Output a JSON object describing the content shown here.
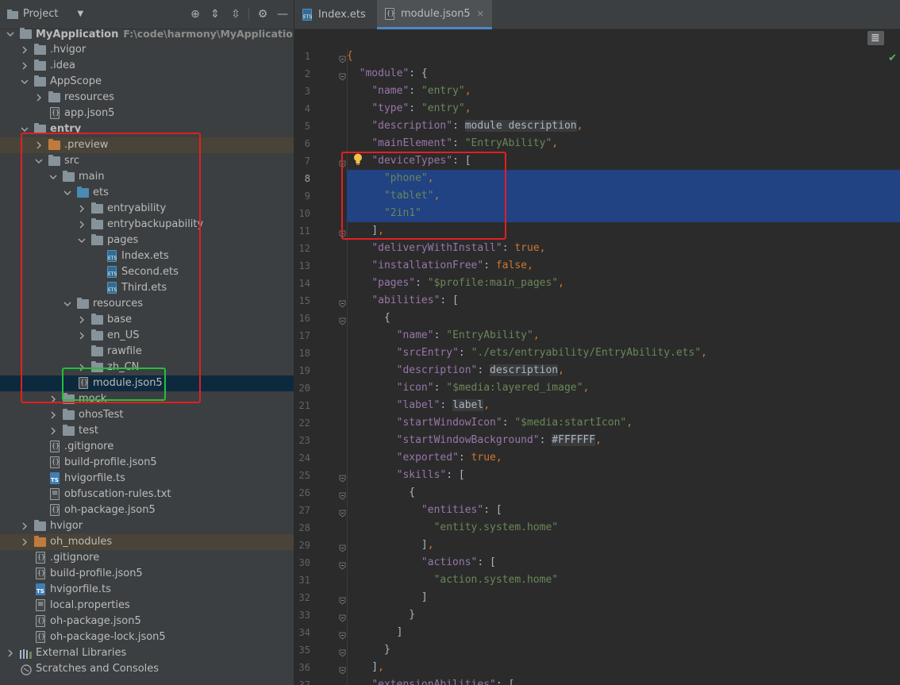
{
  "project_panel": {
    "title": "Project",
    "header_icons": [
      "locate-icon",
      "expand-all-icon",
      "collapse-all-icon",
      "settings-icon",
      "hide-icon"
    ],
    "tree": [
      {
        "label": "MyApplication",
        "path": "F:\\code\\harmony\\MyApplication",
        "icon": "module-folder",
        "level": 0,
        "expanded": true,
        "bold": true
      },
      {
        "label": ".hvigor",
        "icon": "folder",
        "level": 1,
        "expanded": false
      },
      {
        "label": ".idea",
        "icon": "folder",
        "level": 1,
        "expanded": false
      },
      {
        "label": "AppScope",
        "icon": "folder",
        "level": 1,
        "expanded": true
      },
      {
        "label": "resources",
        "icon": "folder",
        "level": 2,
        "expanded": false
      },
      {
        "label": "app.json5",
        "icon": "json-file",
        "level": 2
      },
      {
        "label": "entry",
        "icon": "module-folder",
        "level": 1,
        "expanded": true,
        "bold": true
      },
      {
        "label": ".preview",
        "icon": "orange-folder",
        "level": 2,
        "expanded": false,
        "highlight": "orange"
      },
      {
        "label": "src",
        "icon": "folder",
        "level": 2,
        "expanded": true
      },
      {
        "label": "main",
        "icon": "folder",
        "level": 3,
        "expanded": true
      },
      {
        "label": "ets",
        "icon": "blue-folder",
        "level": 4,
        "expanded": true
      },
      {
        "label": "entryability",
        "icon": "folder",
        "level": 5,
        "expanded": false
      },
      {
        "label": "entrybackupability",
        "icon": "folder",
        "level": 5,
        "expanded": false
      },
      {
        "label": "pages",
        "icon": "folder",
        "level": 5,
        "expanded": true
      },
      {
        "label": "Index.ets",
        "icon": "ets-file",
        "level": 6
      },
      {
        "label": "Second.ets",
        "icon": "ets-file",
        "level": 6
      },
      {
        "label": "Third.ets",
        "icon": "ets-file",
        "level": 6
      },
      {
        "label": "resources",
        "icon": "folder",
        "level": 4,
        "expanded": true
      },
      {
        "label": "base",
        "icon": "folder",
        "level": 5,
        "expanded": false
      },
      {
        "label": "en_US",
        "icon": "folder",
        "level": 5,
        "expanded": false
      },
      {
        "label": "rawfile",
        "icon": "folder",
        "level": 5
      },
      {
        "label": "zh_CN",
        "icon": "folder",
        "level": 5,
        "expanded": false
      },
      {
        "label": "module.json5",
        "icon": "json-file",
        "level": 4,
        "selected": true
      },
      {
        "label": "mock",
        "icon": "folder",
        "level": 3,
        "expanded": false
      },
      {
        "label": "ohosTest",
        "icon": "folder",
        "level": 3,
        "expanded": false
      },
      {
        "label": "test",
        "icon": "folder",
        "level": 3,
        "expanded": false
      },
      {
        "label": ".gitignore",
        "icon": "json-file",
        "level": 2
      },
      {
        "label": "build-profile.json5",
        "icon": "json-file",
        "level": 2
      },
      {
        "label": "hvigorfile.ts",
        "icon": "ts-file",
        "level": 2
      },
      {
        "label": "obfuscation-rules.txt",
        "icon": "txt-file",
        "level": 2
      },
      {
        "label": "oh-package.json5",
        "icon": "json-file",
        "level": 2
      },
      {
        "label": "hvigor",
        "icon": "folder",
        "level": 1,
        "expanded": false
      },
      {
        "label": "oh_modules",
        "icon": "orange-folder",
        "level": 1,
        "expanded": false,
        "highlight": "orange"
      },
      {
        "label": ".gitignore",
        "icon": "json-file",
        "level": 1
      },
      {
        "label": "build-profile.json5",
        "icon": "json-file",
        "level": 1
      },
      {
        "label": "hvigorfile.ts",
        "icon": "ts-file",
        "level": 1
      },
      {
        "label": "local.properties",
        "icon": "txt-file",
        "level": 1
      },
      {
        "label": "oh-package.json5",
        "icon": "json-file",
        "level": 1
      },
      {
        "label": "oh-package-lock.json5",
        "icon": "json-file",
        "level": 1
      },
      {
        "label": "External Libraries",
        "icon": "library",
        "level": 0,
        "expanded": false
      },
      {
        "label": "Scratches and Consoles",
        "icon": "scratches",
        "level": 0
      }
    ]
  },
  "editor": {
    "tabs": [
      {
        "label": "Index.ets",
        "icon": "ets-file",
        "active": false
      },
      {
        "label": "module.json5",
        "icon": "json-file",
        "active": true
      }
    ],
    "close_glyph": "✕",
    "lines": [
      {
        "n": "1",
        "tokens": [
          [
            "pun",
            "{"
          ]
        ]
      },
      {
        "n": "2",
        "tokens": [
          [
            "ind",
            "  "
          ],
          [
            "key",
            "\"module\""
          ],
          [
            "ind",
            ": {"
          ]
        ]
      },
      {
        "n": "3",
        "tokens": [
          [
            "ind",
            "    "
          ],
          [
            "key",
            "\"name\""
          ],
          [
            "ind",
            ": "
          ],
          [
            "str",
            "\"entry\""
          ],
          [
            "pun",
            ","
          ]
        ]
      },
      {
        "n": "4",
        "tokens": [
          [
            "ind",
            "    "
          ],
          [
            "key",
            "\"type\""
          ],
          [
            "ind",
            ": "
          ],
          [
            "str",
            "\"entry\""
          ],
          [
            "pun",
            ","
          ]
        ]
      },
      {
        "n": "5",
        "tokens": [
          [
            "ind",
            "    "
          ],
          [
            "key",
            "\"description\""
          ],
          [
            "ind",
            ": "
          ],
          [
            "ref",
            "module description"
          ],
          [
            "pun",
            ","
          ]
        ]
      },
      {
        "n": "6",
        "tokens": [
          [
            "ind",
            "    "
          ],
          [
            "key",
            "\"mainElement\""
          ],
          [
            "ind",
            ": "
          ],
          [
            "str",
            "\"EntryAbility\""
          ],
          [
            "pun",
            ","
          ]
        ]
      },
      {
        "n": "7",
        "tokens": [
          [
            "ind",
            "    "
          ],
          [
            "key",
            "\"deviceTypes\""
          ],
          [
            "ind",
            ": ["
          ]
        ]
      },
      {
        "n": "8",
        "tokens": [
          [
            "ind",
            "      "
          ],
          [
            "str",
            "\"phone\""
          ],
          [
            "pun",
            ","
          ]
        ],
        "selected": true
      },
      {
        "n": "9",
        "tokens": [
          [
            "ind",
            "      "
          ],
          [
            "str",
            "\"tablet\""
          ],
          [
            "pun",
            ","
          ]
        ],
        "selected": true
      },
      {
        "n": "10",
        "tokens": [
          [
            "ind",
            "      "
          ],
          [
            "str",
            "\"2in1\""
          ]
        ],
        "selected": true
      },
      {
        "n": "11",
        "tokens": [
          [
            "ind",
            "    ]"
          ],
          [
            "pun",
            ","
          ]
        ]
      },
      {
        "n": "12",
        "tokens": [
          [
            "ind",
            "    "
          ],
          [
            "key",
            "\"deliveryWithInstall\""
          ],
          [
            "ind",
            ": "
          ],
          [
            "kw",
            "true"
          ],
          [
            "pun",
            ","
          ]
        ]
      },
      {
        "n": "13",
        "tokens": [
          [
            "ind",
            "    "
          ],
          [
            "key",
            "\"installationFree\""
          ],
          [
            "ind",
            ": "
          ],
          [
            "kw",
            "false"
          ],
          [
            "pun",
            ","
          ]
        ]
      },
      {
        "n": "14",
        "tokens": [
          [
            "ind",
            "    "
          ],
          [
            "key",
            "\"pages\""
          ],
          [
            "ind",
            ": "
          ],
          [
            "str",
            "\"$profile:main_pages\""
          ],
          [
            "pun",
            ","
          ]
        ]
      },
      {
        "n": "15",
        "tokens": [
          [
            "ind",
            "    "
          ],
          [
            "key",
            "\"abilities\""
          ],
          [
            "ind",
            ": ["
          ]
        ]
      },
      {
        "n": "16",
        "tokens": [
          [
            "ind",
            "      {"
          ]
        ]
      },
      {
        "n": "17",
        "tokens": [
          [
            "ind",
            "        "
          ],
          [
            "key",
            "\"name\""
          ],
          [
            "ind",
            ": "
          ],
          [
            "str",
            "\"EntryAbility\""
          ],
          [
            "pun",
            ","
          ]
        ]
      },
      {
        "n": "18",
        "tokens": [
          [
            "ind",
            "        "
          ],
          [
            "key",
            "\"srcEntry\""
          ],
          [
            "ind",
            ": "
          ],
          [
            "str",
            "\"./ets/entryability/EntryAbility.ets\""
          ],
          [
            "pun",
            ","
          ]
        ]
      },
      {
        "n": "19",
        "tokens": [
          [
            "ind",
            "        "
          ],
          [
            "key",
            "\"description\""
          ],
          [
            "ind",
            ": "
          ],
          [
            "ref",
            "description"
          ],
          [
            "pun",
            ","
          ]
        ]
      },
      {
        "n": "20",
        "tokens": [
          [
            "ind",
            "        "
          ],
          [
            "key",
            "\"icon\""
          ],
          [
            "ind",
            ": "
          ],
          [
            "str",
            "\"$media:layered_image\""
          ],
          [
            "pun",
            ","
          ]
        ]
      },
      {
        "n": "21",
        "tokens": [
          [
            "ind",
            "        "
          ],
          [
            "key",
            "\"label\""
          ],
          [
            "ind",
            ": "
          ],
          [
            "ref",
            "label"
          ],
          [
            "pun",
            ","
          ]
        ]
      },
      {
        "n": "22",
        "tokens": [
          [
            "ind",
            "        "
          ],
          [
            "key",
            "\"startWindowIcon\""
          ],
          [
            "ind",
            ": "
          ],
          [
            "str",
            "\"$media:startIcon\""
          ],
          [
            "pun",
            ","
          ]
        ]
      },
      {
        "n": "23",
        "tokens": [
          [
            "ind",
            "        "
          ],
          [
            "key",
            "\"startWindowBackground\""
          ],
          [
            "ind",
            ": "
          ],
          [
            "ref",
            "#FFFFFF"
          ],
          [
            "pun",
            ","
          ]
        ]
      },
      {
        "n": "24",
        "tokens": [
          [
            "ind",
            "        "
          ],
          [
            "key",
            "\"exported\""
          ],
          [
            "ind",
            ": "
          ],
          [
            "kw",
            "true"
          ],
          [
            "pun",
            ","
          ]
        ]
      },
      {
        "n": "25",
        "tokens": [
          [
            "ind",
            "        "
          ],
          [
            "key",
            "\"skills\""
          ],
          [
            "ind",
            ": ["
          ]
        ]
      },
      {
        "n": "26",
        "tokens": [
          [
            "ind",
            "          {"
          ]
        ]
      },
      {
        "n": "27",
        "tokens": [
          [
            "ind",
            "            "
          ],
          [
            "key",
            "\"entities\""
          ],
          [
            "ind",
            ": ["
          ]
        ]
      },
      {
        "n": "28",
        "tokens": [
          [
            "ind",
            "              "
          ],
          [
            "str",
            "\"entity.system.home\""
          ]
        ]
      },
      {
        "n": "29",
        "tokens": [
          [
            "ind",
            "            ]"
          ],
          [
            "pun",
            ","
          ]
        ]
      },
      {
        "n": "30",
        "tokens": [
          [
            "ind",
            "            "
          ],
          [
            "key",
            "\"actions\""
          ],
          [
            "ind",
            ": ["
          ]
        ]
      },
      {
        "n": "31",
        "tokens": [
          [
            "ind",
            "              "
          ],
          [
            "str",
            "\"action.system.home\""
          ]
        ]
      },
      {
        "n": "32",
        "tokens": [
          [
            "ind",
            "            ]"
          ]
        ]
      },
      {
        "n": "33",
        "tokens": [
          [
            "ind",
            "          }"
          ]
        ]
      },
      {
        "n": "34",
        "tokens": [
          [
            "ind",
            "        ]"
          ]
        ]
      },
      {
        "n": "35",
        "tokens": [
          [
            "ind",
            "      }"
          ]
        ]
      },
      {
        "n": "36",
        "tokens": [
          [
            "ind",
            "    ]"
          ],
          [
            "pun",
            ","
          ]
        ]
      },
      {
        "n": "37",
        "tokens": [
          [
            "ind",
            "    "
          ],
          [
            "key",
            "\"extensionAbilities\""
          ],
          [
            "ind",
            ": ["
          ]
        ]
      }
    ],
    "colors": {
      "key": "#9876aa",
      "string": "#6a8759",
      "keyword": "#cc7832",
      "selection": "#214283",
      "annotation_red": "#e02020",
      "annotation_green": "#22c03a"
    }
  }
}
